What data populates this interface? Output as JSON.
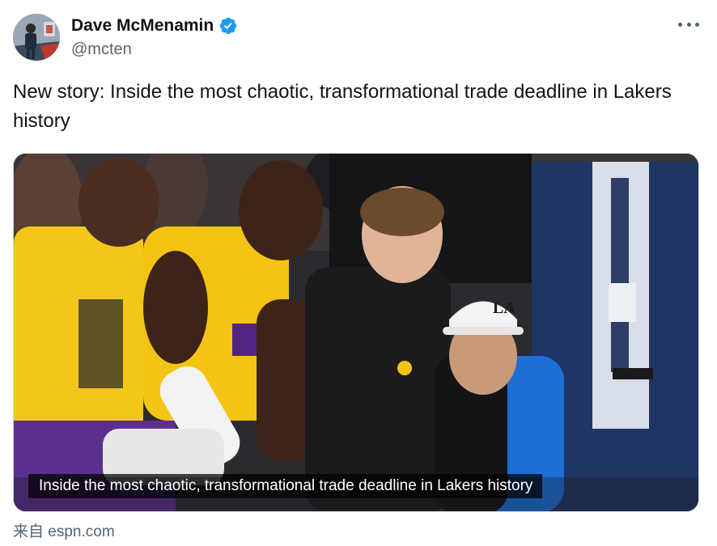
{
  "author": {
    "display_name": "Dave McMenamin",
    "handle": "@mcten",
    "verified": true,
    "avatar_icon": "profile-photo"
  },
  "menu": {
    "icon": "more-horizontal-icon"
  },
  "tweet": {
    "text": "New story: Inside the most chaotic, transformational trade deadline in Lakers history"
  },
  "media": {
    "caption": "Inside the most chaotic, transformational trade deadline in Lakers history"
  },
  "link_source": {
    "text": "来自 espn.com"
  },
  "colors": {
    "verified_blue": "#1d9bf0",
    "secondary_text": "#536471",
    "lakers_gold": "#f5c313",
    "lakers_purple": "#552583"
  }
}
